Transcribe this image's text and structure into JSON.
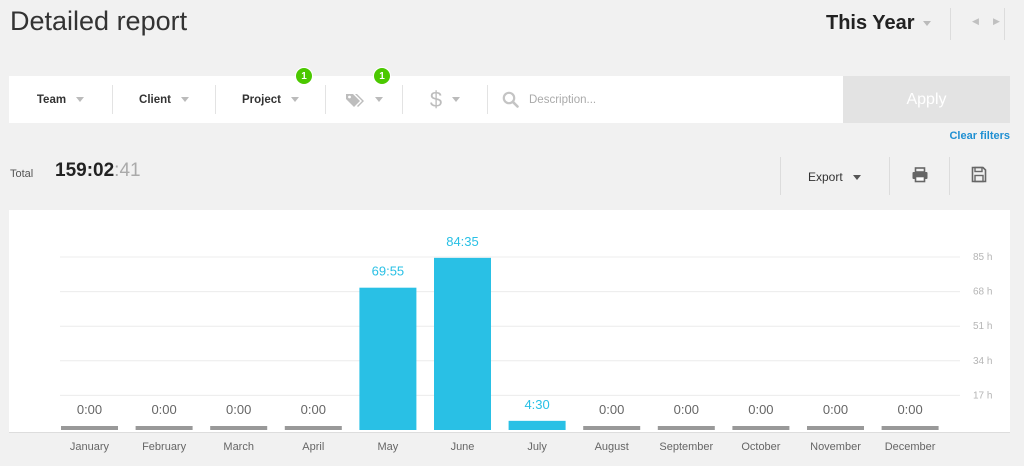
{
  "header": {
    "title": "Detailed report",
    "period": "This Year"
  },
  "filters": {
    "team_label": "Team",
    "client_label": "Client",
    "project_label": "Project",
    "project_badge": "1",
    "tags_badge": "1",
    "search_placeholder": "Description...",
    "apply_label": "Apply",
    "clear_label": "Clear filters"
  },
  "summary": {
    "total_label": "Total",
    "total_hm": "159:02",
    "total_sec": ":41",
    "export_label": "Export"
  },
  "icons": {
    "tags": "tag-icon",
    "billable": "dollar-icon",
    "search": "search-icon",
    "print": "print-icon",
    "save": "save-icon"
  },
  "colors": {
    "bar": "#29c0e5",
    "zero_bar": "#999999",
    "badge": "#4bc800",
    "link": "#1f8fd2"
  },
  "chart_data": {
    "type": "bar",
    "categories": [
      "January",
      "February",
      "March",
      "April",
      "May",
      "June",
      "July",
      "August",
      "September",
      "October",
      "November",
      "December"
    ],
    "values": [
      0,
      0,
      0,
      0,
      69.92,
      84.58,
      4.5,
      0,
      0,
      0,
      0,
      0
    ],
    "labels": [
      "0:00",
      "0:00",
      "0:00",
      "0:00",
      "69:55",
      "84:35",
      "4:30",
      "0:00",
      "0:00",
      "0:00",
      "0:00",
      "0:00"
    ],
    "yticks": [
      17,
      34,
      51,
      68,
      85
    ],
    "ytick_labels": [
      "17 h",
      "34 h",
      "51 h",
      "68 h",
      "85 h"
    ],
    "ylim": [
      0,
      85
    ],
    "grid": true
  }
}
